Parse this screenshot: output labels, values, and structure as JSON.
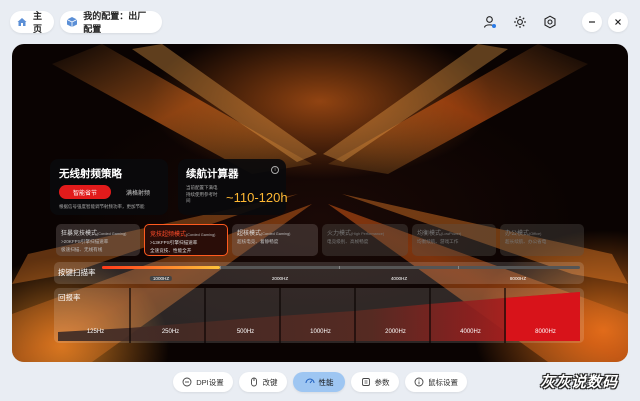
{
  "header": {
    "home_label": "主页",
    "config_label": "我的配置：出厂配置"
  },
  "wireless": {
    "title": "无线射频策略",
    "option_smart": "智能省节",
    "option_strict": "满格射频",
    "description": "根据信号强度智能调节射频功率，更加节能"
  },
  "battery": {
    "title": "续航计算器",
    "subtitle": "当前配置下满电持续使用参考时间",
    "hours": "~110-120h"
  },
  "modes": [
    {
      "title": "狂暴竞技模式",
      "en": "(Corded Gaming)",
      "desc1": ">20KFPS引擎扫描速率",
      "desc2": "极速扫描、无线有线",
      "state": "normal"
    },
    {
      "title": "竞技超频模式",
      "en": "(Corded Gaming)",
      "desc1": ">13KFPS引擎扫描速率",
      "desc2": "全速竞技、性能全开",
      "state": "active"
    },
    {
      "title": "超核模式",
      "en": "(Corded Gaming)",
      "desc1": "超核电竞、着静畅度",
      "desc2": "",
      "state": "normal"
    },
    {
      "title": "火力模式",
      "en": "(High Performance)",
      "desc1": "电竞级别、高帧畅度",
      "desc2": "",
      "state": "dim"
    },
    {
      "title": "均衡模式",
      "en": "(LowPower)",
      "desc1": "均衡续航、游戏工作",
      "desc2": "",
      "state": "dim"
    },
    {
      "title": "办公模式",
      "en": "(Office)",
      "desc1": "超长续航、办公省电",
      "desc2": "",
      "state": "dim"
    }
  ],
  "scan_rate": {
    "label": "按键扫描率",
    "options": [
      "1000HZ",
      "2000HZ",
      "4000HZ",
      "8000HZ"
    ],
    "selected": "1000HZ"
  },
  "report_rate": {
    "label": "回报率",
    "options": [
      "125Hz",
      "250Hz",
      "500Hz",
      "1000Hz",
      "2000Hz",
      "4000Hz",
      "8000Hz"
    ],
    "selected": "8000Hz"
  },
  "nav": {
    "tabs": [
      {
        "label": "DPI设置",
        "icon": "dpi-icon"
      },
      {
        "label": "改键",
        "icon": "mouse-icon"
      },
      {
        "label": "性能",
        "icon": "performance-icon",
        "active": true
      },
      {
        "label": "参数",
        "icon": "params-icon"
      },
      {
        "label": "鼠标设置",
        "icon": "info-icon"
      }
    ]
  },
  "colors": {
    "accent_red": "#e21b1b",
    "active_nav": "#9ec6f2",
    "battery_value": "#ffb833",
    "active_mode_border": "#ff5a1f"
  },
  "watermark": "灰灰说数码"
}
